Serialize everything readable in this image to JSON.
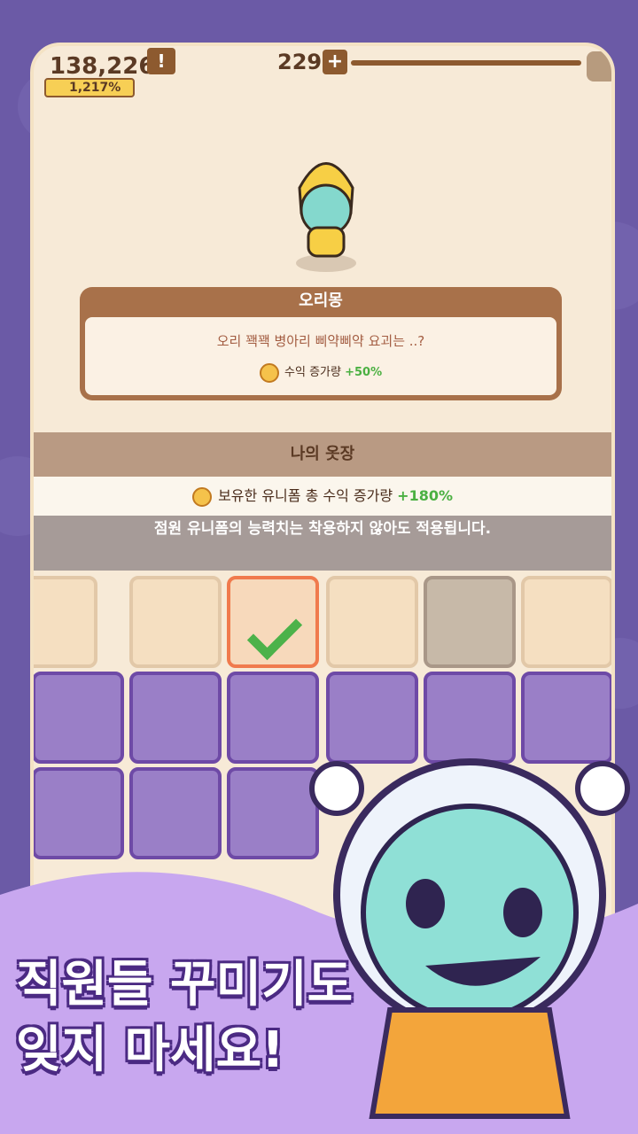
{
  "topbar": {
    "money": "138,226",
    "money_percent": "1,217%",
    "exclaim": "!",
    "gems": "229",
    "plus": "+"
  },
  "selected_uniform": {
    "name": "오리몽",
    "description": "오리 꽥꽥 병아리 삐약삐약 요괴는 ..?",
    "effect_label": "수익 증가량",
    "effect_value": "+50%"
  },
  "wardrobe": {
    "title": "나의 옷장",
    "total_label": "보유한 유니폼 총 수익 증가량",
    "total_value": "+180%",
    "note": "점원 유니폼의 능력치는 착용하지 않아도 적용됩니다."
  },
  "promo": {
    "line1": "직원들 꾸미기도",
    "line2": "잊지 마세요!"
  },
  "colors": {
    "accent": "#f07a4d",
    "positive": "#4bb042",
    "brand_purple": "#6b5aa6"
  }
}
